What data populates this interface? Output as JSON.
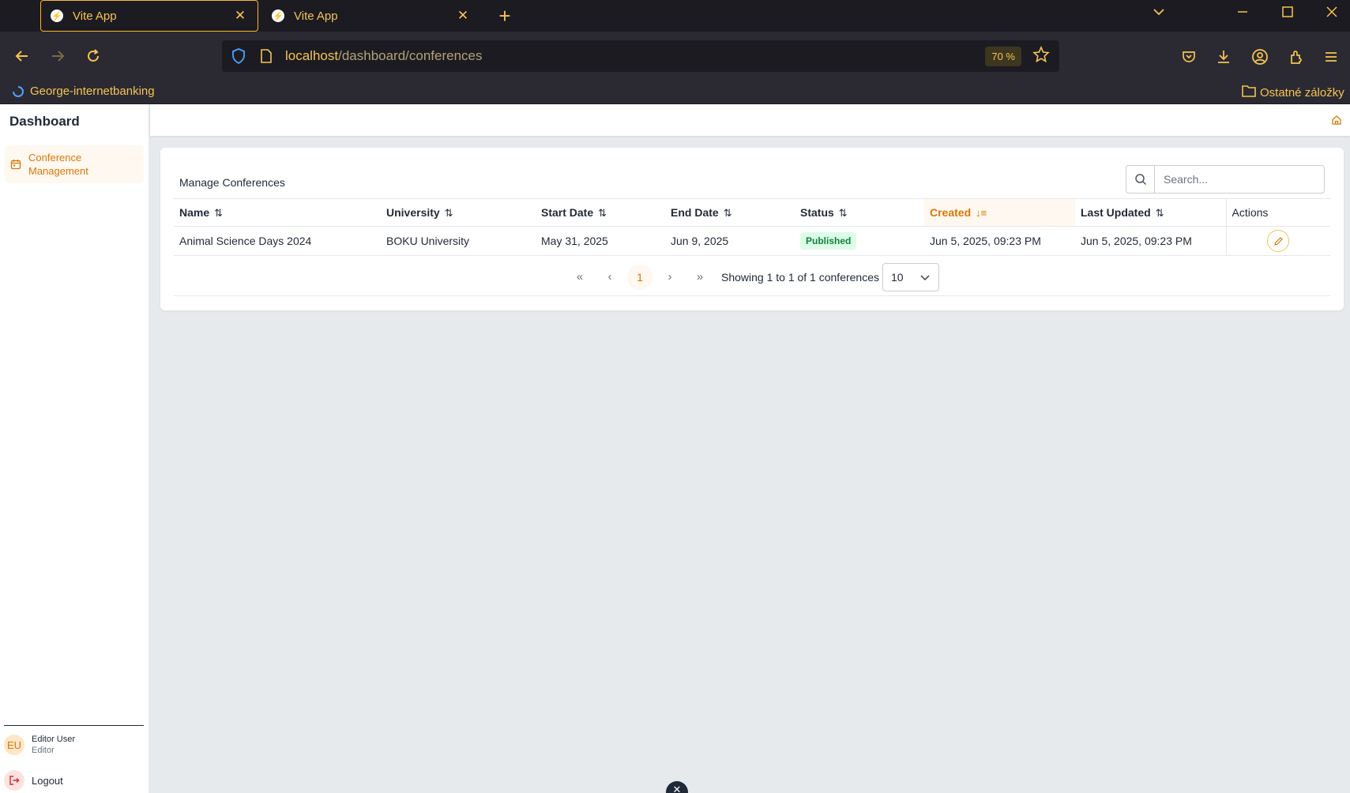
{
  "browser": {
    "tabs": [
      {
        "title": "Vite App",
        "active": true
      },
      {
        "title": "Vite App",
        "active": false
      }
    ],
    "url_host": "localhost",
    "url_path": "/dashboard/conferences",
    "zoom": "70 %",
    "bookmarks": {
      "left": "George-internetbanking",
      "right": "Ostatné záložky"
    }
  },
  "sidebar": {
    "brand": "Dashboard",
    "items": [
      {
        "label": "Conference Management",
        "icon": "calendar-icon",
        "active": true
      }
    ],
    "user": {
      "initials": "EU",
      "name": "Editor User",
      "role": "Editor"
    },
    "logout_label": "Logout"
  },
  "main": {
    "card_title": "Manage Conferences",
    "search_placeholder": "Search...",
    "columns": [
      {
        "label": "Name",
        "sort": "none"
      },
      {
        "label": "University",
        "sort": "none"
      },
      {
        "label": "Start Date",
        "sort": "none"
      },
      {
        "label": "End Date",
        "sort": "none"
      },
      {
        "label": "Status",
        "sort": "none"
      },
      {
        "label": "Created",
        "sort": "desc"
      },
      {
        "label": "Last Updated",
        "sort": "none"
      },
      {
        "label": "Actions"
      }
    ],
    "rows": [
      {
        "name": "Animal Science Days 2024",
        "university": "BOKU University",
        "start_date": "May 31, 2025",
        "end_date": "Jun 9, 2025",
        "status": "Published",
        "created": "Jun 5, 2025, 09:23 PM",
        "updated": "Jun 5, 2025, 09:23 PM"
      }
    ],
    "pagination": {
      "current_page": "1",
      "info": "Showing 1 to 1 of 1 conferences",
      "page_size": "10"
    }
  },
  "colors": {
    "accent": "#d97706",
    "browser_accent": "#f5c451",
    "status_published_bg": "#dcfce7",
    "status_published_fg": "#15803d"
  }
}
